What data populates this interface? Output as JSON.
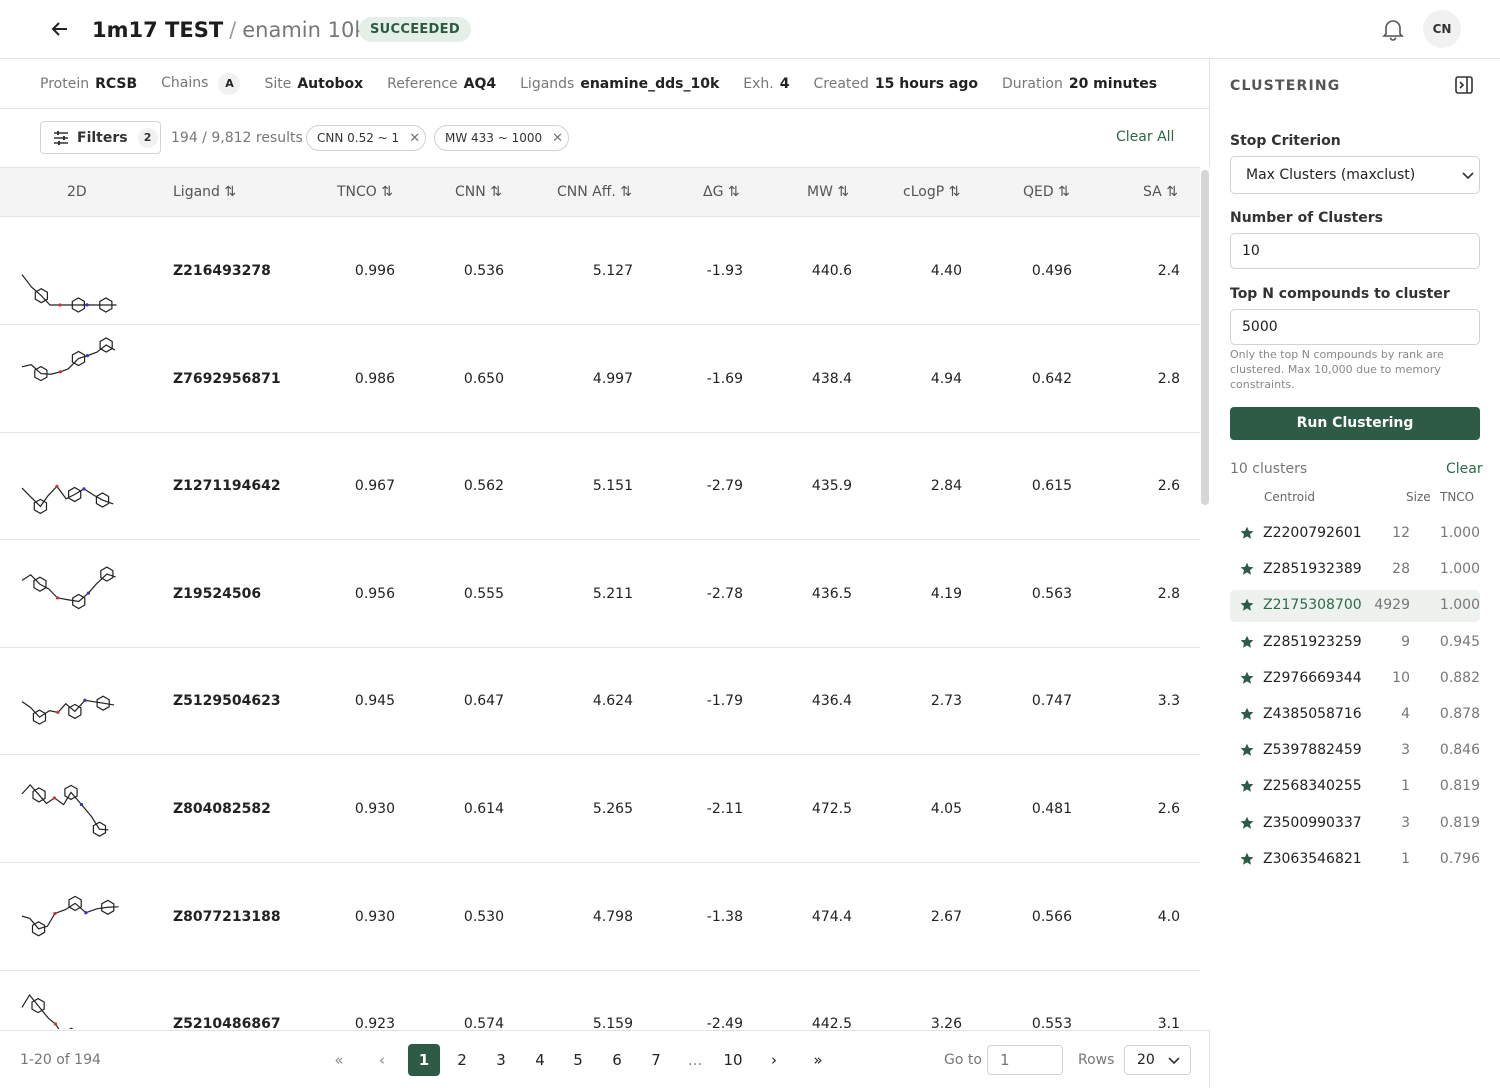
{
  "header": {
    "project": "1m17 TEST",
    "separator": "/",
    "job_name": "enamin 10k",
    "status": "SUCCEEDED",
    "avatar_initials": "CN"
  },
  "meta": {
    "protein_label": "Protein",
    "protein": "RCSB",
    "chains_label": "Chains",
    "chain": "A",
    "site_label": "Site",
    "site": "Autobox",
    "reference_label": "Reference",
    "reference": "AQ4",
    "ligands_label": "Ligands",
    "ligands": "enamine_dds_10k",
    "exh_label": "Exh.",
    "exh": "4",
    "created_label": "Created",
    "created": "15 hours ago",
    "duration_label": "Duration",
    "duration": "20 minutes"
  },
  "filterbar": {
    "filters_label": "Filters",
    "filters_count": "2",
    "results": "194 / 9,812 results",
    "chips": [
      "CNN 0.52 ~ 1",
      "MW 433 ~ 1000"
    ],
    "clear_all": "Clear All"
  },
  "table": {
    "headers": [
      "2D",
      "Ligand",
      "TNCO",
      "CNN",
      "CNN Aff.",
      "ΔG",
      "MW",
      "cLogP",
      "QED",
      "SA"
    ],
    "sort_glyph": "⇅",
    "rows": [
      {
        "ligand": "Z216493278",
        "tnco": "0.996",
        "cnn": "0.536",
        "cnn_aff": "5.127",
        "dg": "-1.93",
        "mw": "440.6",
        "clogp": "4.40",
        "qed": "0.496",
        "sa": "2.4"
      },
      {
        "ligand": "Z7692956871",
        "tnco": "0.986",
        "cnn": "0.650",
        "cnn_aff": "4.997",
        "dg": "-1.69",
        "mw": "438.4",
        "clogp": "4.94",
        "qed": "0.642",
        "sa": "2.8"
      },
      {
        "ligand": "Z1271194642",
        "tnco": "0.967",
        "cnn": "0.562",
        "cnn_aff": "5.151",
        "dg": "-2.79",
        "mw": "435.9",
        "clogp": "2.84",
        "qed": "0.615",
        "sa": "2.6"
      },
      {
        "ligand": "Z19524506",
        "tnco": "0.956",
        "cnn": "0.555",
        "cnn_aff": "5.211",
        "dg": "-2.78",
        "mw": "436.5",
        "clogp": "4.19",
        "qed": "0.563",
        "sa": "2.8"
      },
      {
        "ligand": "Z5129504623",
        "tnco": "0.945",
        "cnn": "0.647",
        "cnn_aff": "4.624",
        "dg": "-1.79",
        "mw": "436.4",
        "clogp": "2.73",
        "qed": "0.747",
        "sa": "3.3"
      },
      {
        "ligand": "Z804082582",
        "tnco": "0.930",
        "cnn": "0.614",
        "cnn_aff": "5.265",
        "dg": "-2.11",
        "mw": "472.5",
        "clogp": "4.05",
        "qed": "0.481",
        "sa": "2.6"
      },
      {
        "ligand": "Z8077213188",
        "tnco": "0.930",
        "cnn": "0.530",
        "cnn_aff": "4.798",
        "dg": "-1.38",
        "mw": "474.4",
        "clogp": "2.67",
        "qed": "0.566",
        "sa": "4.0"
      },
      {
        "ligand": "Z5210486867",
        "tnco": "0.923",
        "cnn": "0.574",
        "cnn_aff": "5.159",
        "dg": "-2.49",
        "mw": "442.5",
        "clogp": "3.26",
        "qed": "0.553",
        "sa": "3.1"
      }
    ]
  },
  "pager": {
    "range": "1-20 of 194",
    "first": "«",
    "prev": "‹",
    "pages": [
      "1",
      "2",
      "3",
      "4",
      "5",
      "6",
      "7",
      "...",
      "10"
    ],
    "active_page": "1",
    "next": "›",
    "last": "»",
    "goto_label": "Go to",
    "goto_placeholder": "1",
    "rows_label": "Rows",
    "rows_value": "20"
  },
  "sidebar": {
    "title": "CLUSTERING",
    "stop_label": "Stop Criterion",
    "stop_value": "Max Clusters (maxclust)",
    "nclusters_label": "Number of Clusters",
    "nclusters_value": "10",
    "topn_label": "Top N compounds to cluster",
    "topn_value": "5000",
    "help": "Only the top N compounds by rank are clustered. Max 10,000 due to memory constraints.",
    "run_label": "Run Clustering",
    "count": "10 clusters",
    "clear": "Clear",
    "col_centroid": "Centroid",
    "col_size": "Size",
    "col_tnco": "TNCO",
    "clusters": [
      {
        "id": "Z2200792601",
        "size": "12",
        "tnco": "1.000"
      },
      {
        "id": "Z2851932389",
        "size": "28",
        "tnco": "1.000"
      },
      {
        "id": "Z2175308700",
        "size": "4929",
        "tnco": "1.000"
      },
      {
        "id": "Z2851923259",
        "size": "9",
        "tnco": "0.945"
      },
      {
        "id": "Z2976669344",
        "size": "10",
        "tnco": "0.882"
      },
      {
        "id": "Z4385058716",
        "size": "4",
        "tnco": "0.878"
      },
      {
        "id": "Z5397882459",
        "size": "3",
        "tnco": "0.846"
      },
      {
        "id": "Z2568340255",
        "size": "1",
        "tnco": "0.819"
      },
      {
        "id": "Z3500990337",
        "size": "3",
        "tnco": "0.819"
      },
      {
        "id": "Z3063546821",
        "size": "1",
        "tnco": "0.796"
      }
    ],
    "selected_index": 2
  },
  "colors": {
    "accent": "#2d5b46",
    "link": "#2d6a48",
    "badge_bg": "#e3efe7"
  }
}
